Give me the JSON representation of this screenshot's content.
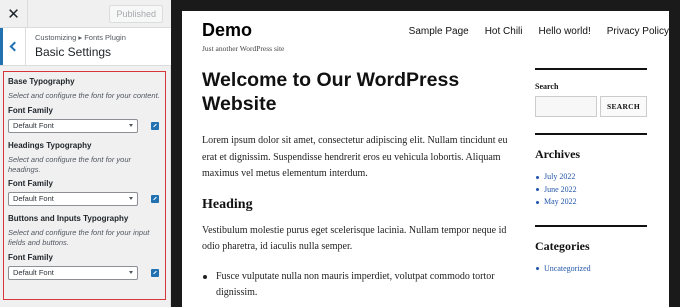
{
  "panel": {
    "close_icon": "close-icon",
    "publish_label": "Published",
    "back_icon": "chevron-left-icon",
    "breadcrumb": "Customizing ▸ Fonts Plugin",
    "section_title": "Basic Settings",
    "accent_color": "#2271b1",
    "highlight_border_color": "#d63638",
    "groups": [
      {
        "title": "Base Typography",
        "description": "Select and configure the font for your content.",
        "field_label": "Font Family",
        "selected": "Default Font"
      },
      {
        "title": "Headings Typography",
        "description": "Select and configure the font for your headings.",
        "field_label": "Font Family",
        "selected": "Default Font"
      },
      {
        "title": "Buttons and Inputs Typography",
        "description": "Select and configure the font for your input fields and buttons.",
        "field_label": "Font Family",
        "selected": "Default Font"
      }
    ]
  },
  "site": {
    "title": "Demo",
    "tagline": "Just another WordPress site",
    "nav": [
      "Sample Page",
      "Hot Chili",
      "Hello world!",
      "Privacy Policy"
    ],
    "post": {
      "title": "Welcome to Our WordPress Website",
      "paragraph1": "Lorem ipsum dolor sit amet, consectetur adipiscing elit. Nullam tincidunt eu erat et dignissim. Suspendisse hendrerit eros eu vehicula lobortis. Aliquam maximus vel metus elementum interdum.",
      "heading": "Heading",
      "paragraph2": "Vestibulum molestie purus eget scelerisque lacinia. Nullam tempor neque id odio pharetra, id iaculis nulla semper.",
      "bullets": [
        "Fusce vulputate nulla non mauris imperdiet, volutpat commodo tortor dignissim."
      ]
    },
    "sidebar": {
      "search_title": "Search",
      "search_button": "SEARCH",
      "archives_title": "Archives",
      "archives": [
        "July 2022",
        "June 2022",
        "May 2022"
      ],
      "categories_title": "Categories",
      "categories": [
        "Uncategorized"
      ]
    }
  }
}
